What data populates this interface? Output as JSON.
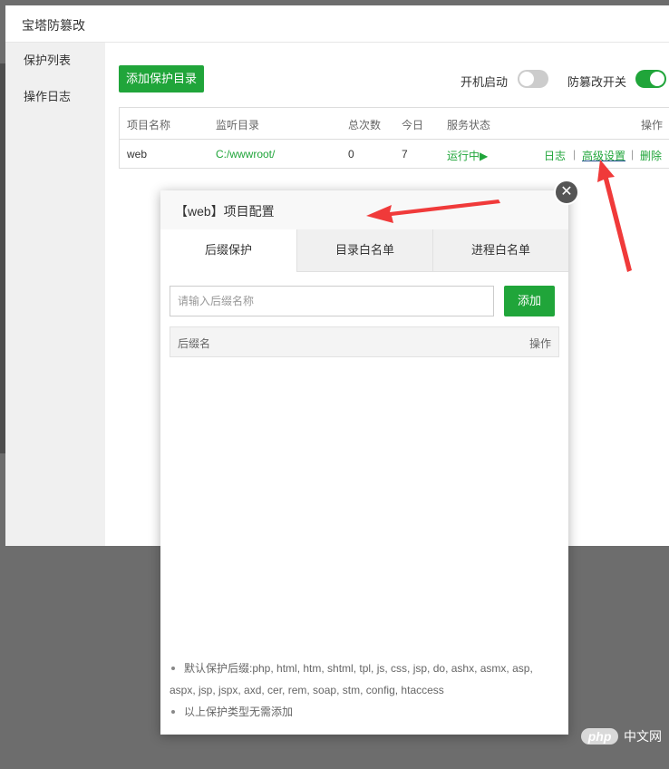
{
  "window": {
    "title": "宝塔防篡改",
    "sidebar": [
      {
        "label": "保护列表",
        "active": true
      },
      {
        "label": "操作日志",
        "active": false
      }
    ]
  },
  "toolbar": {
    "add_button": "添加保护目录",
    "boot_label": "开机启动",
    "boot_on": false,
    "tamper_label": "防篡改开关",
    "tamper_on": true
  },
  "table": {
    "headers": [
      "项目名称",
      "监听目录",
      "总次数",
      "今日",
      "服务状态",
      "操作"
    ],
    "rows": [
      {
        "name": "web",
        "dir": "C:/wwwroot/",
        "total": "0",
        "today": "7",
        "status": "运行中▶",
        "actions": {
          "log": "日志",
          "sep1": "|",
          "advanced": "高级设置",
          "sep2": "|",
          "delete": "删除"
        }
      }
    ]
  },
  "modal": {
    "title": "【web】项目配置",
    "close_glyph": "✕",
    "tabs": [
      "后缀保护",
      "目录白名单",
      "进程白名单"
    ],
    "input_placeholder": "请输入后缀名称",
    "add_button": "添加",
    "list_headers": {
      "name": "后缀名",
      "action": "操作"
    },
    "tips": [
      "默认保护后缀:php, html, htm, shtml, tpl, js, css, jsp, do, ashx, asmx, asp, aspx, jsp, jspx, axd, cer, rem, soap, stm, config, htaccess",
      "以上保护类型无需添加"
    ]
  },
  "watermark": {
    "brand": "php",
    "site": "中文网"
  },
  "colors": {
    "accent_green": "#20a53a",
    "arrow_red": "#f03a3a",
    "overlay": "#6d6d6d"
  }
}
